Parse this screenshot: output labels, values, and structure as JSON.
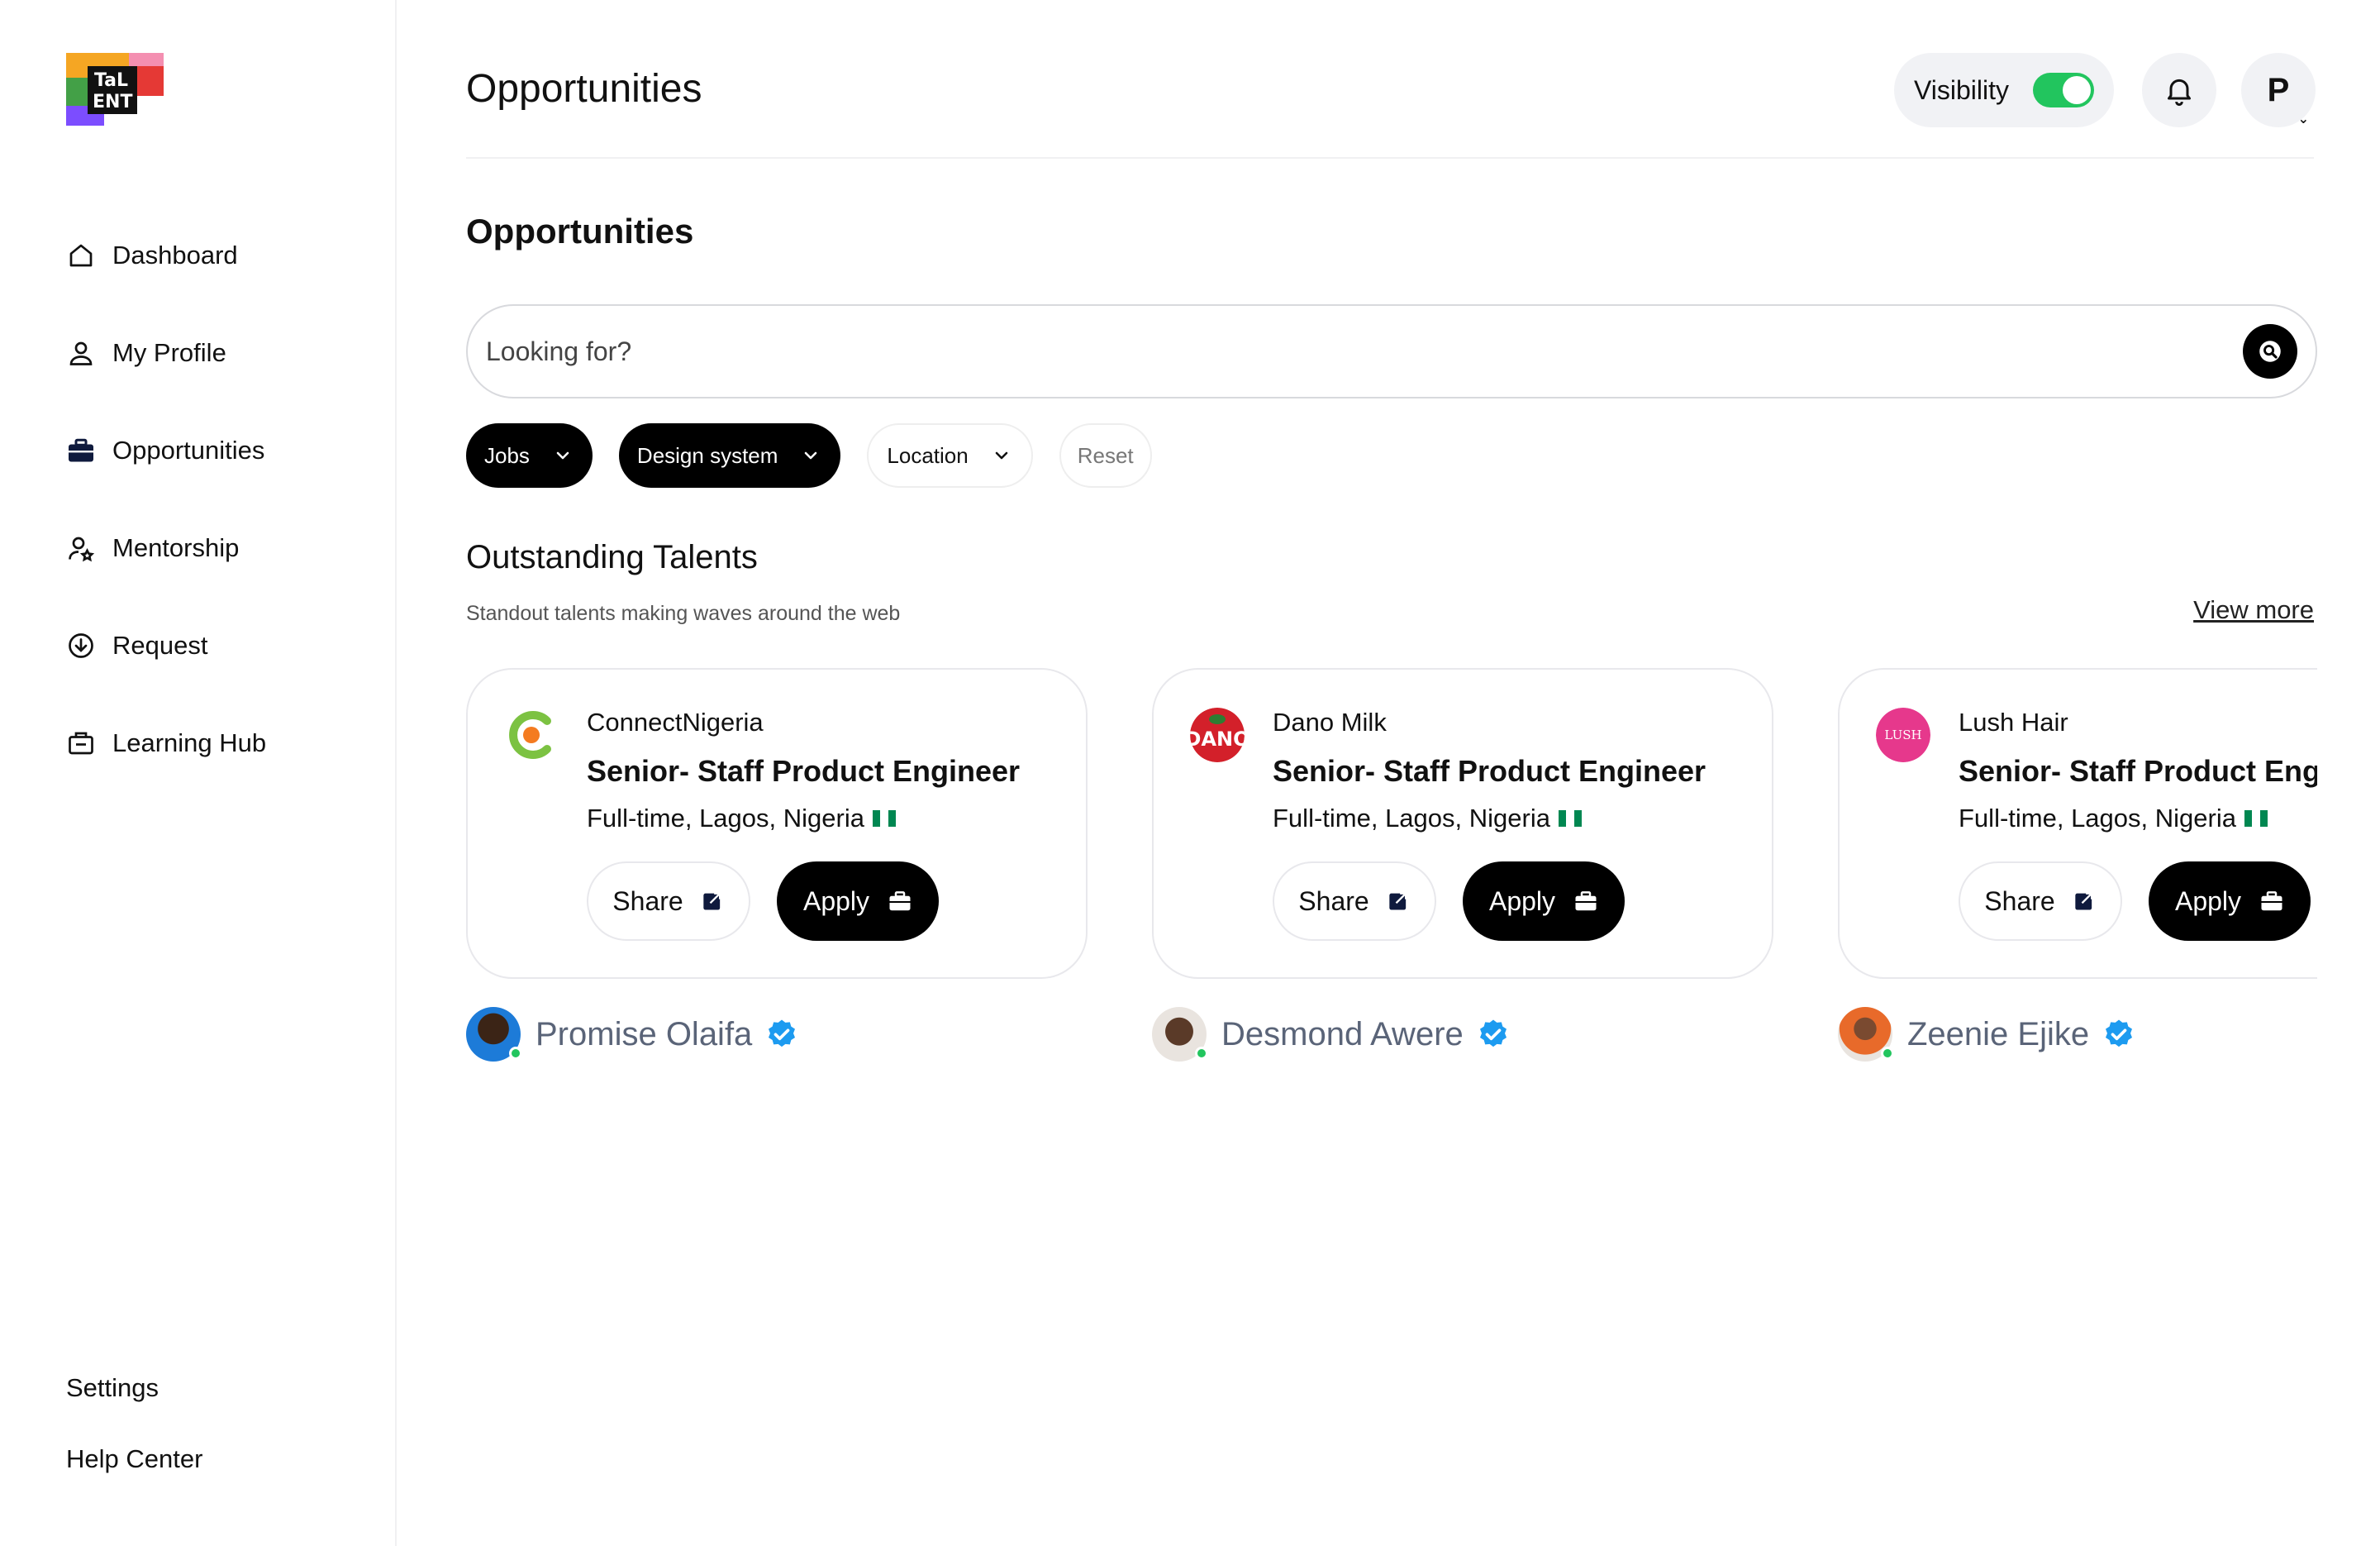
{
  "app": {
    "logo_text": "TALENT"
  },
  "sidebar": {
    "items": [
      {
        "label": "Dashboard",
        "icon": "home-icon"
      },
      {
        "label": "My Profile",
        "icon": "user-icon"
      },
      {
        "label": "Opportunities",
        "icon": "briefcase-icon"
      },
      {
        "label": "Mentorship",
        "icon": "mentorship-icon"
      },
      {
        "label": "Request",
        "icon": "download-circle-icon"
      },
      {
        "label": "Learning Hub",
        "icon": "learning-icon"
      }
    ],
    "bottom": [
      {
        "label": "Settings"
      },
      {
        "label": "Help Center"
      }
    ]
  },
  "header": {
    "title": "Opportunities",
    "visibility_label": "Visibility",
    "visibility_on": true,
    "avatar_initial": "P"
  },
  "main": {
    "section_title": "Opportunities",
    "search": {
      "placeholder": "Looking for?"
    },
    "filters": [
      {
        "label": "Jobs",
        "style": "dark"
      },
      {
        "label": "Design system",
        "style": "dark"
      },
      {
        "label": "Location",
        "style": "light"
      }
    ],
    "reset_label": "Reset",
    "talents": {
      "title": "Outstanding Talents",
      "subtitle": "Standout talents making waves around the web",
      "view_more": "View more",
      "cards": [
        {
          "company": "ConnectNigeria",
          "role": "Senior- Staff Product Engineer",
          "meta": "Full-time, Lagos, Nigeria",
          "share": "Share",
          "apply": "Apply",
          "talent": "Promise Olaifa",
          "logo_color": "#7cc242"
        },
        {
          "company": "Dano Milk",
          "role": "Senior- Staff Product Engineer",
          "meta": "Full-time, Lagos, Nigeria",
          "share": "Share",
          "apply": "Apply",
          "talent": "Desmond Awere",
          "logo_color": "#d3202a"
        },
        {
          "company": "Lush Hair",
          "role": "Senior- Staff Product Engineer",
          "meta": "Full-time, Lagos, Nigeria",
          "share": "Share",
          "apply": "Apply",
          "talent": "Zeenie Ejike",
          "logo_color": "#e6388c"
        }
      ]
    }
  },
  "colors": {
    "accent_toggle": "#22c55e",
    "verified": "#1d9bf0",
    "primary_button": "#000000"
  }
}
